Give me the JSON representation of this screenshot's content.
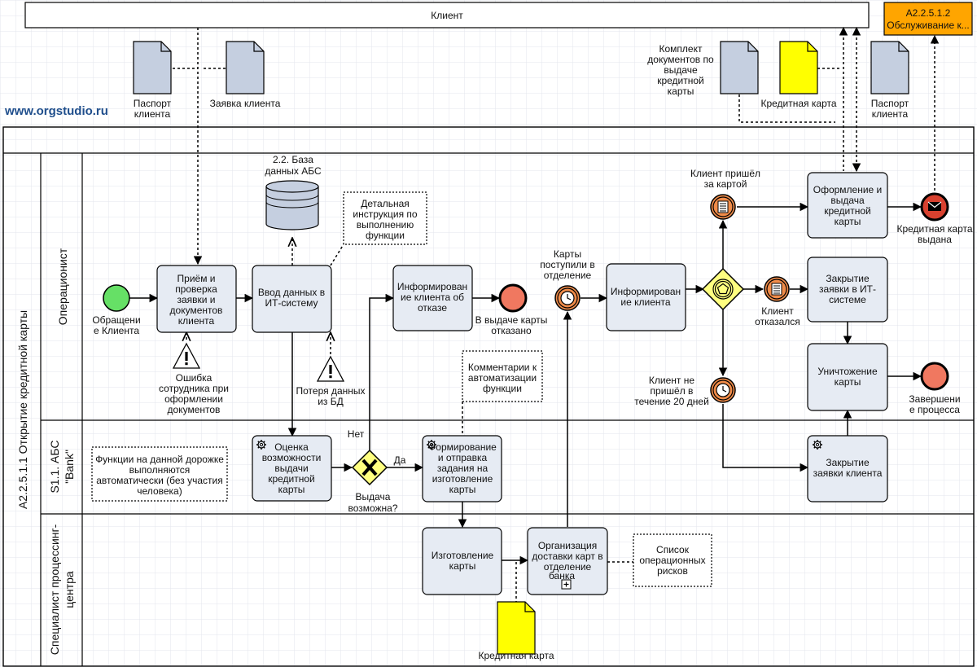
{
  "pools": {
    "client": "Клиент",
    "linked_process_line1": "А2.2.5.1.2",
    "linked_process_line2": "Обслуживание к...",
    "main_process": "А2.2.5.1.1 Открытие кредитной карты"
  },
  "watermark": "www.orgstudio.ru",
  "lanes": {
    "operator": "Операционист",
    "abs_line1": "S1.1. АБС",
    "abs_line2": "\"Bank\"",
    "processing_line1": "Специалист процессинг-",
    "processing_line2": "центра"
  },
  "docs": {
    "passport_top_l1": "Паспорт",
    "passport_top_l2": "клиента",
    "request": "Заявка клиента",
    "kit_l1": "Комплект",
    "kit_l2": "документов по",
    "kit_l3": "выдаче",
    "kit_l4": "кредитной",
    "kit_l5": "карты",
    "credit_card_top": "Кредитная карта",
    "passport_right_l1": "Паспорт",
    "passport_right_l2": "клиента",
    "credit_card_bottom": "Кредитная карта"
  },
  "db": {
    "l1": "2.2. База",
    "l2": "данных АБС"
  },
  "annotations": {
    "instruction_l1": "Детальная",
    "instruction_l2": "инструкция по",
    "instruction_l3": "выполнению",
    "instruction_l4": "функции",
    "automation_l1": "Комментарии к",
    "automation_l2": "автоматизации",
    "automation_l3": "функции",
    "auto_lane_l1": "Функции на данной дорожке",
    "auto_lane_l2": "выполняются",
    "auto_lane_l3": "автоматически (без участия",
    "auto_lane_l4": "человека)",
    "risks_l1": "Список",
    "risks_l2": "операционных",
    "risks_l3": "рисков"
  },
  "risks": {
    "r1_l1": "Ошибка",
    "r1_l2": "сотрудника при",
    "r1_l3": "оформлении",
    "r1_l4": "документов",
    "r2_l1": "Потеря данных",
    "r2_l2": "из БД"
  },
  "tasks": {
    "t1_l1": "Приём и",
    "t1_l2": "проверка",
    "t1_l3": "заявки и",
    "t1_l4": "документов",
    "t1_l5": "клиента",
    "t2_l1": "Ввод данных в",
    "t2_l2": "ИТ-систему",
    "t3_l1": "Информирован",
    "t3_l2": "ие клиента об",
    "t3_l3": "отказе",
    "t4_l1": "Информирован",
    "t4_l2": "ие клиента",
    "t5_l1": "Оформление и",
    "t5_l2": "выдача",
    "t5_l3": "кредитной",
    "t5_l4": "карты",
    "t6_l1": "Закрытие",
    "t6_l2": "заявки в ИТ-",
    "t6_l3": "системе",
    "t7_l1": "Уничтожение",
    "t7_l2": "карты",
    "t8_l1": "Оценка",
    "t8_l2": "возможности",
    "t8_l3": "выдачи",
    "t8_l4": "кредитной",
    "t8_l5": "карты",
    "t9_l1": "Формирование",
    "t9_l2": "и отправка",
    "t9_l3": "задания на",
    "t9_l4": "изготовление",
    "t9_l5": "карты",
    "t10_l1": "Закрытие",
    "t10_l2": "заявки клиента",
    "t11_l1": "Изготовление",
    "t11_l2": "карты",
    "t12_l1": "Организация",
    "t12_l2": "доставки карт в",
    "t12_l3": "отделение",
    "t12_l4": "банка"
  },
  "events": {
    "start_l1": "Обращени",
    "start_l2": "е Клиента",
    "refused_l1": "В выдаче карты",
    "refused_l2": "отказано",
    "cards_arrived_l1": "Карты",
    "cards_arrived_l2": "поступили в",
    "cards_arrived_l3": "отделение",
    "came_l1": "Клиент пришёл",
    "came_l2": "за картой",
    "declined_l1": "Клиент",
    "declined_l2": "отказался",
    "no_show_l1": "Клиент не",
    "no_show_l2": "пришёл в",
    "no_show_l3": "течение 20 дней",
    "issued_l1": "Кредитная карта",
    "issued_l2": "выдана",
    "end_l1": "Завершени",
    "end_l2": "е процесса"
  },
  "gateways": {
    "possible_l1": "Выдача",
    "possible_l2": "возможна?",
    "no": "Нет",
    "yes": "Да"
  },
  "colors": {
    "task_fill": "#e6ebf3",
    "doc_fill": "#c5cfe0",
    "doc_yellow": "#ffff00",
    "start_fill": "#66e066",
    "end_fill": "#f07860",
    "intermediate_fill": "#f08c4a",
    "gateway_fill": "#ffff80",
    "linked_process_fill": "#ffa500",
    "message_end_fill": "#d8412f"
  }
}
